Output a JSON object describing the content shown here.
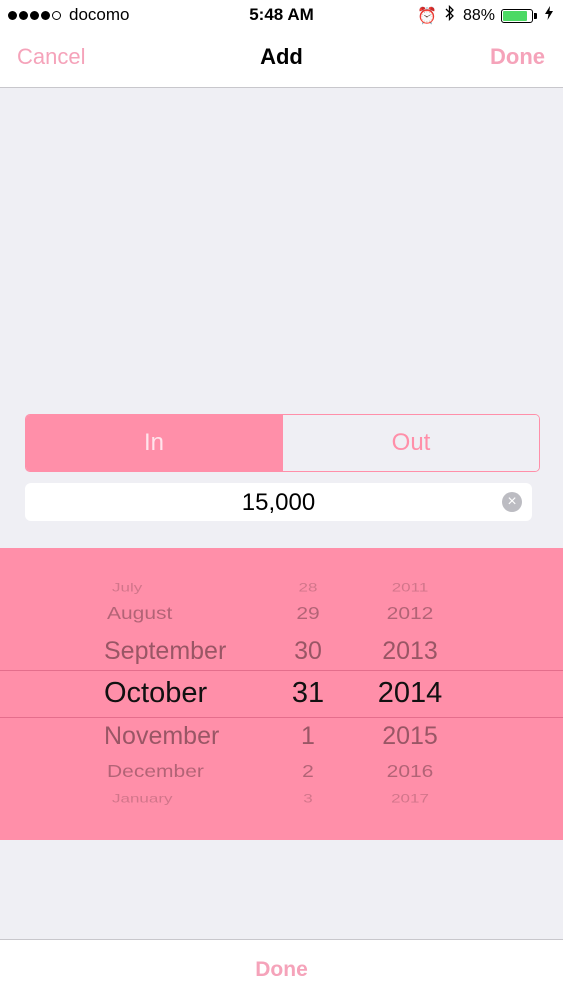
{
  "status_bar": {
    "carrier": "docomo",
    "time": "5:48 AM",
    "battery_percent": "88%",
    "battery_level": 0.88,
    "icons": [
      "alarm-icon",
      "bluetooth-icon",
      "battery-icon",
      "charging-icon"
    ]
  },
  "nav": {
    "cancel_label": "Cancel",
    "title": "Add",
    "done_label": "Done"
  },
  "segmented": {
    "in_label": "In",
    "out_label": "Out",
    "selected": "In"
  },
  "amount": {
    "value": "15,000"
  },
  "picker": {
    "months": [
      "July",
      "August",
      "September",
      "October",
      "November",
      "December",
      "January"
    ],
    "days": [
      "28",
      "29",
      "30",
      "31",
      "1",
      "2",
      "3"
    ],
    "years": [
      "2011",
      "2012",
      "2013",
      "2014",
      "2015",
      "2016",
      "2017"
    ],
    "selected": {
      "month": "October",
      "day": "31",
      "year": "2014"
    }
  },
  "toolbar": {
    "done_label": "Done"
  },
  "colors": {
    "accent": "#ff8fa9",
    "accent_light": "#f5a3ba",
    "background": "#efeff4"
  }
}
